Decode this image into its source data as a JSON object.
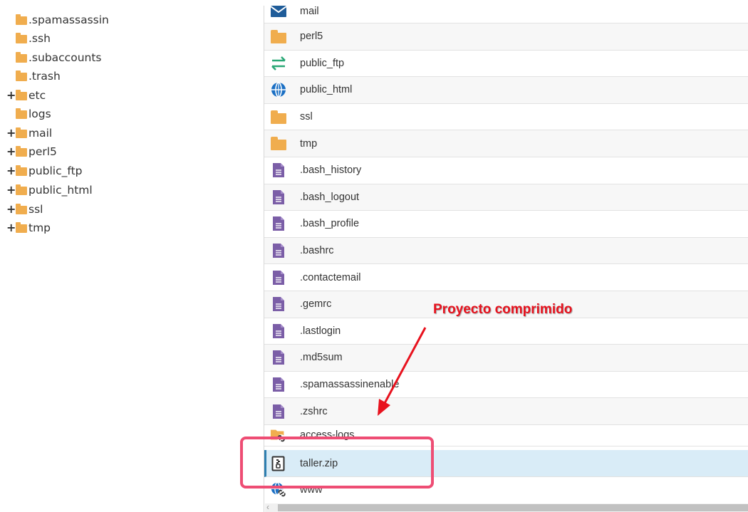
{
  "tree": {
    "items": [
      {
        "label": ".spamassassin",
        "expandable": false
      },
      {
        "label": ".ssh",
        "expandable": false
      },
      {
        "label": ".subaccounts",
        "expandable": false
      },
      {
        "label": ".trash",
        "expandable": false
      },
      {
        "label": "etc",
        "expandable": true,
        "expand_symbol": "+"
      },
      {
        "label": "logs",
        "expandable": false
      },
      {
        "label": "mail",
        "expandable": true,
        "expand_symbol": "+"
      },
      {
        "label": "perl5",
        "expandable": true,
        "expand_symbol": "+"
      },
      {
        "label": "public_ftp",
        "expandable": true,
        "expand_symbol": "+"
      },
      {
        "label": "public_html",
        "expandable": true,
        "expand_symbol": "+"
      },
      {
        "label": "ssl",
        "expandable": true,
        "expand_symbol": "+"
      },
      {
        "label": "tmp",
        "expandable": true,
        "expand_symbol": "+"
      }
    ]
  },
  "files": [
    {
      "name": "mail",
      "icon": "envelope-icon"
    },
    {
      "name": "perl5",
      "icon": "folder-icon"
    },
    {
      "name": "public_ftp",
      "icon": "transfer-arrows-icon"
    },
    {
      "name": "public_html",
      "icon": "globe-icon"
    },
    {
      "name": "ssl",
      "icon": "folder-icon"
    },
    {
      "name": "tmp",
      "icon": "folder-icon"
    },
    {
      "name": ".bash_history",
      "icon": "text-file-icon"
    },
    {
      "name": ".bash_logout",
      "icon": "text-file-icon"
    },
    {
      "name": ".bash_profile",
      "icon": "text-file-icon"
    },
    {
      "name": ".bashrc",
      "icon": "text-file-icon"
    },
    {
      "name": ".contactemail",
      "icon": "text-file-icon"
    },
    {
      "name": ".gemrc",
      "icon": "text-file-icon"
    },
    {
      "name": ".lastlogin",
      "icon": "text-file-icon"
    },
    {
      "name": ".md5sum",
      "icon": "text-file-icon"
    },
    {
      "name": ".spamassassinenable",
      "icon": "text-file-icon"
    },
    {
      "name": ".zshrc",
      "icon": "text-file-icon"
    },
    {
      "name": "access-logs",
      "icon": "folder-link-icon"
    },
    {
      "name": "taller.zip",
      "icon": "zip-file-icon",
      "selected": true
    },
    {
      "name": "www",
      "icon": "globe-link-icon"
    }
  ],
  "annotation": {
    "text": "Proyecto comprimido",
    "color": "#e8121e",
    "highlight_color": "#ee4d74"
  },
  "colors": {
    "folder": "#f0ad4e",
    "text_file": "#7b5ea7",
    "envelope": "#1f5c99",
    "transfer": "#2aa876",
    "globe": "#1a6fc4",
    "selected_row": "#d9ecf7"
  }
}
